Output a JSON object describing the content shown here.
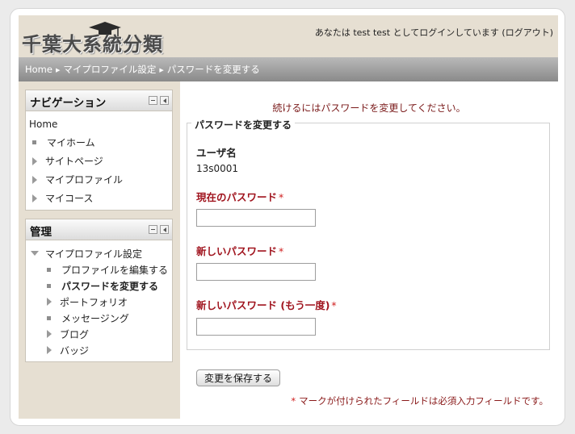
{
  "header": {
    "logo_text": "千葉大系統分類",
    "login_text": "あなたは test test としてログインしています (ログアウト)"
  },
  "breadcrumb": {
    "items": [
      "Home",
      "マイプロファイル設定",
      "パスワードを変更する"
    ]
  },
  "navigation": {
    "title": "ナビゲーション",
    "home": "Home",
    "items": [
      {
        "label": "マイホーム",
        "bullet": "square"
      },
      {
        "label": "サイトページ",
        "bullet": "triangle"
      },
      {
        "label": "マイプロファイル",
        "bullet": "triangle"
      },
      {
        "label": "マイコース",
        "bullet": "triangle"
      }
    ]
  },
  "admin": {
    "title": "管理",
    "section": "マイプロファイル設定",
    "items": [
      {
        "label": "プロファイルを編集する",
        "bullet": "square"
      },
      {
        "label": "パスワードを変更する",
        "bullet": "square"
      },
      {
        "label": "ポートフォリオ",
        "bullet": "triangle"
      },
      {
        "label": "メッセージング",
        "bullet": "square"
      },
      {
        "label": "ブログ",
        "bullet": "triangle"
      },
      {
        "label": "バッジ",
        "bullet": "triangle"
      }
    ]
  },
  "main": {
    "notice": "続けるにはパスワードを変更してください。",
    "legend": "パスワードを変更する",
    "username_label": "ユーザ名",
    "username_value": "13s0001",
    "current_password_label": "現在のパスワード",
    "new_password_label": "新しいパスワード",
    "new_password_again_label": "新しいパスワード (もう一度)",
    "required_star": "*",
    "save_button": "変更を保存する",
    "required_note": "マークが付けられたフィールドは必須入力フィールドです。"
  },
  "colors": {
    "required_label": "#a0141e",
    "notice_text": "#7a1a1a",
    "header_bg": "#e6dfd2"
  }
}
